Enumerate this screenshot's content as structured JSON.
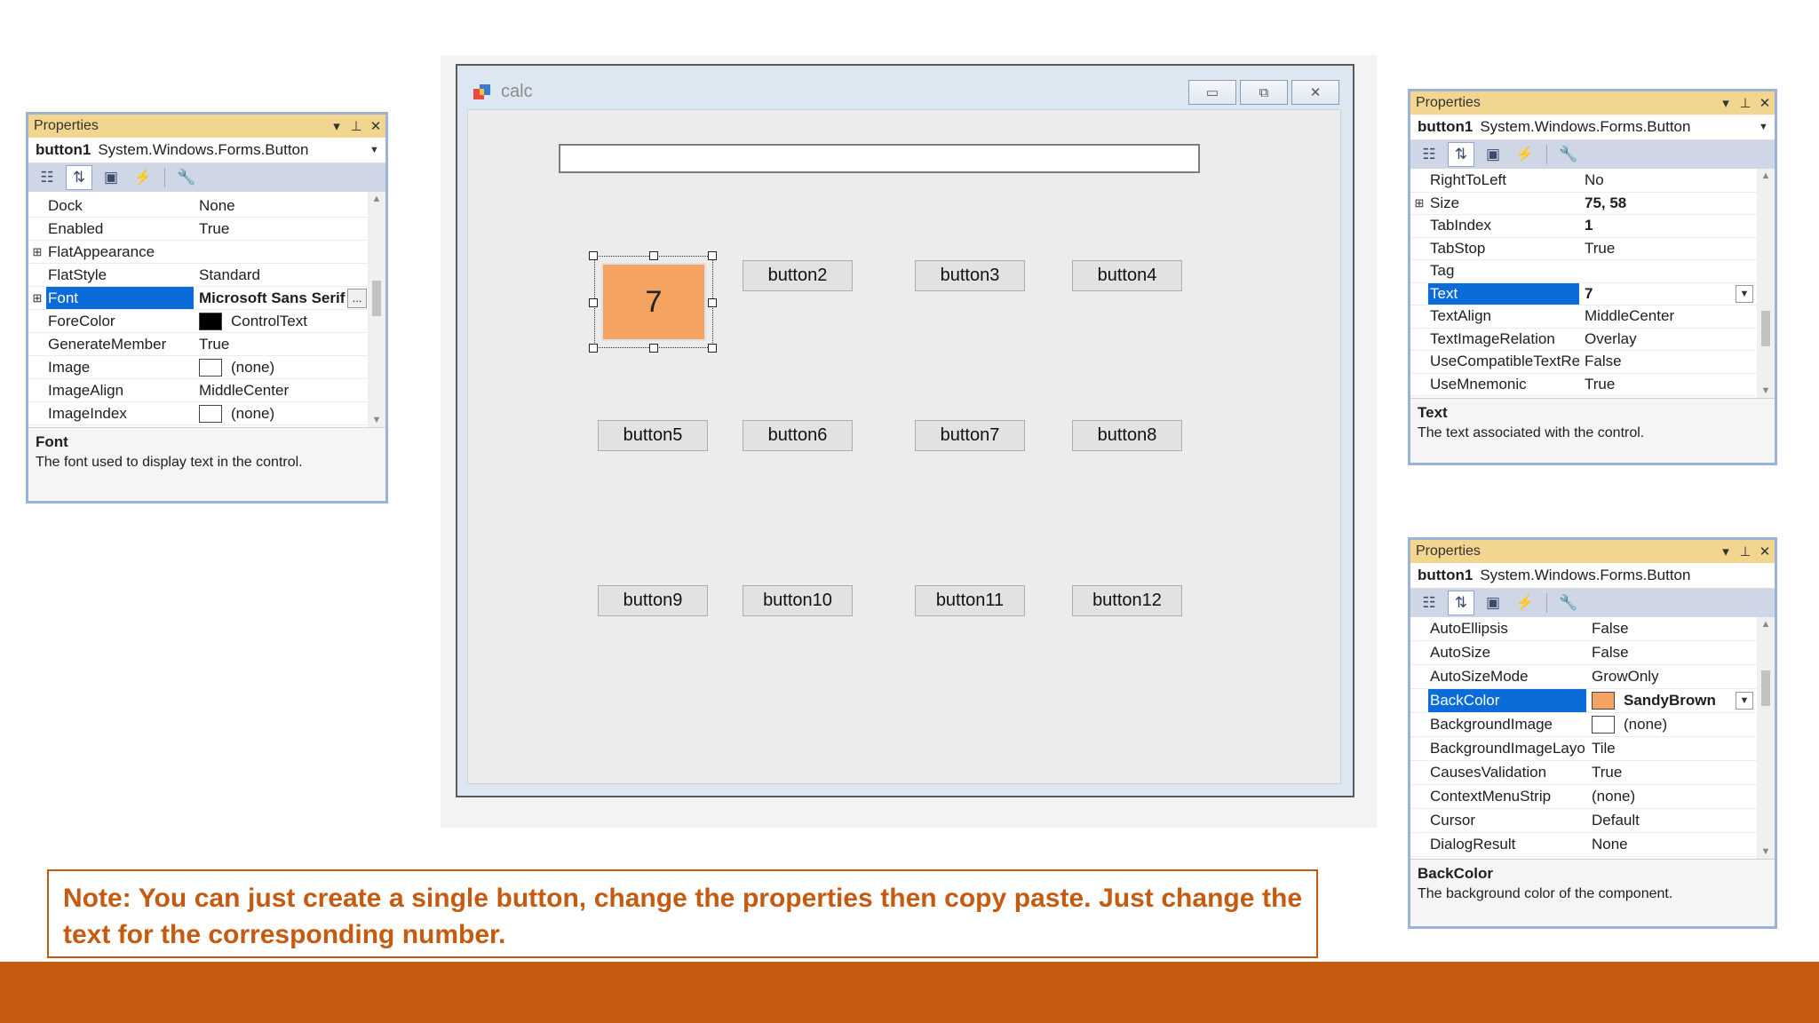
{
  "props_left": {
    "title": "Properties",
    "object_name": "button1",
    "object_type": "System.Windows.Forms.Button",
    "rows": [
      {
        "name": "Dock",
        "value": "None"
      },
      {
        "name": "Enabled",
        "value": "True"
      },
      {
        "name": "FlatAppearance",
        "value": "",
        "expand": "⊞"
      },
      {
        "name": "FlatStyle",
        "value": "Standard"
      },
      {
        "name": "Font",
        "value": "Microsoft Sans Serif",
        "expand": "⊞",
        "selected": true,
        "bold": true
      },
      {
        "name": "ForeColor",
        "value": "ControlText",
        "swatch": "#000000"
      },
      {
        "name": "GenerateMember",
        "value": "True"
      },
      {
        "name": "Image",
        "value": "(none)",
        "swatch": "#ffffff"
      },
      {
        "name": "ImageAlign",
        "value": "MiddleCenter"
      },
      {
        "name": "ImageIndex",
        "value": "(none)",
        "swatch": "#ffffff"
      }
    ],
    "ellipsis": "...",
    "desc_title": "Font",
    "desc_text": "The font used to display text in the control."
  },
  "props_right_top": {
    "title": "Properties",
    "object_name": "button1",
    "object_type": "System.Windows.Forms.Button",
    "rows": [
      {
        "name": "RightToLeft",
        "value": "No"
      },
      {
        "name": "Size",
        "value": "75, 58",
        "expand": "⊞",
        "bold": true
      },
      {
        "name": "TabIndex",
        "value": "1",
        "bold": true
      },
      {
        "name": "TabStop",
        "value": "True"
      },
      {
        "name": "Tag",
        "value": ""
      },
      {
        "name": "Text",
        "value": "7",
        "selected": true,
        "bold": true,
        "dropdown": true
      },
      {
        "name": "TextAlign",
        "value": "MiddleCenter"
      },
      {
        "name": "TextImageRelation",
        "value": "Overlay"
      },
      {
        "name": "UseCompatibleTextRen",
        "value": "False"
      },
      {
        "name": "UseMnemonic",
        "value": "True"
      }
    ],
    "desc_title": "Text",
    "desc_text": "The text associated with the control."
  },
  "props_right_bottom": {
    "title": "Properties",
    "object_name": "button1",
    "object_type": "System.Windows.Forms.Button",
    "rows": [
      {
        "name": "AutoEllipsis",
        "value": "False"
      },
      {
        "name": "AutoSize",
        "value": "False"
      },
      {
        "name": "AutoSizeMode",
        "value": "GrowOnly"
      },
      {
        "name": "BackColor",
        "value": "SandyBrown",
        "selected": true,
        "bold": true,
        "swatch": "#f4a460",
        "dropdown": true
      },
      {
        "name": "BackgroundImage",
        "value": "(none)",
        "swatch": "#ffffff"
      },
      {
        "name": "BackgroundImageLayout",
        "value": "Tile"
      },
      {
        "name": "CausesValidation",
        "value": "True"
      },
      {
        "name": "ContextMenuStrip",
        "value": "(none)"
      },
      {
        "name": "Cursor",
        "value": "Default"
      },
      {
        "name": "DialogResult",
        "value": "None"
      }
    ],
    "desc_title": "BackColor",
    "desc_text": "The background color of the component."
  },
  "form": {
    "title": "calc",
    "selected_button_text": "7",
    "buttons": [
      "button2",
      "button3",
      "button4",
      "button5",
      "button6",
      "button7",
      "button8",
      "button9",
      "button10",
      "button11",
      "button12"
    ],
    "textbox_value": ""
  },
  "note": "Note: You can just create a single button, change the properties then copy paste. Just change the text for the corresponding number.",
  "colors": {
    "accent": "#c55a11",
    "selected_button": "#f4a460",
    "selection": "#0b6cd9",
    "panel_title": "#f2d58f"
  },
  "icons": [
    "categorized-icon",
    "alphabetical-icon",
    "properties-icon",
    "events-icon",
    "property-pages-icon",
    "minimize-icon",
    "maximize-icon",
    "close-icon",
    "pin-icon",
    "dropdown-icon"
  ]
}
